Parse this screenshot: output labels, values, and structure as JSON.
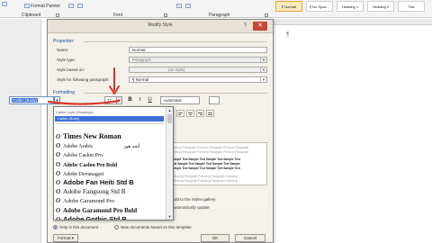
{
  "ribbon": {
    "clipboard_label": "Clipboard",
    "format_painter_label": "Format Painter",
    "font_label": "Font",
    "paragraph_label": "Paragraph",
    "styles": [
      {
        "label": "¶ Normal",
        "selected": true
      },
      {
        "label": "¶ No Spac...",
        "selected": false
      },
      {
        "label": "Heading 1",
        "selected": false
      },
      {
        "label": "Heading 2",
        "selected": false
      },
      {
        "label": "Title",
        "selected": false
      }
    ]
  },
  "document": {
    "paragraph_mark": "¶"
  },
  "dialog": {
    "title": "Modify Style",
    "help_label": "?",
    "close_label": "✕",
    "properties_header": "Properties",
    "fields": [
      {
        "label": "Name:",
        "value": "Normal",
        "disabled": false
      },
      {
        "label": "Style type:",
        "value": "Paragraph",
        "disabled": true
      },
      {
        "label": "Style based on:",
        "value": "(no style)",
        "disabled": true
      },
      {
        "label": "Style for following paragraph:",
        "value": "¶ Normal",
        "disabled": false
      }
    ],
    "formatting_header": "Formatting",
    "font_value": "Calibri (Body)",
    "size_value": "11",
    "bold_label": "B",
    "italic_label": "I",
    "underline_label": "U",
    "color_value": "Automatic",
    "preview_lines": [
      {
        "text": "Previous Paragraph Previous Paragraph Previous Paragraph",
        "style": "grey"
      },
      {
        "text": "Previous Paragraph Previous Paragraph Previous Paragraph",
        "style": "grey"
      },
      {
        "text": "Sample Text Sample Text Sample Text Sample Text",
        "style": "bold"
      },
      {
        "text": "Text Sample Text Sample Text Sample Text Sample",
        "style": "bold"
      },
      {
        "text": "Sample Text Sample Text Sample Text Sample Text",
        "style": "bold"
      },
      {
        "text": "Following Paragraph Following Paragraph Following",
        "style": "grey"
      },
      {
        "text": "Following Paragraph Following Paragraph Following",
        "style": "grey"
      }
    ],
    "add_to_gallery_label": "Add to the Styles gallery",
    "auto_update_label": "Automatically update",
    "only_this_doc_label": "Only in this document",
    "new_docs_label": "New documents based on this template",
    "format_button_label": "Format ▾",
    "ok_label": "OK",
    "cancel_label": "Cancel"
  },
  "font_dropdown": {
    "theme_header": "Calibri Light (Headings)",
    "selected_theme_font": "Calibri (Body)",
    "fonts": [
      {
        "name": "Times New Roman",
        "font": "Liberation Serif",
        "size": 8,
        "bold": true,
        "italic": false
      },
      {
        "name": "Adobe Arabic",
        "font": "Liberation Serif",
        "size": 6,
        "bold": false,
        "italic": false,
        "sample": "أبجد هوز"
      },
      {
        "name": "Adobe Caslon Pro",
        "font": "Liberation Serif",
        "size": 6,
        "bold": false,
        "italic": false
      },
      {
        "name": "Adobe Caslon Pro Bold",
        "font": "Liberation Serif",
        "size": 6,
        "bold": true,
        "italic": false
      },
      {
        "name": "Adobe Devanagari",
        "font": "Liberation Serif",
        "size": 6,
        "bold": false,
        "italic": false
      },
      {
        "name": "Adobe Fan Heiti Std B",
        "font": "Liberation Sans",
        "size": 7.5,
        "bold": true,
        "italic": false
      },
      {
        "name": "Adobe Fangsong Std R",
        "font": "Liberation Serif",
        "size": 7.5,
        "bold": false,
        "italic": false
      },
      {
        "name": "Adobe Garamond Pro",
        "font": "Liberation Serif",
        "size": 6.5,
        "bold": false,
        "italic": false
      },
      {
        "name": "Adobe Garamond Pro Bold",
        "font": "Liberation Serif",
        "size": 7,
        "bold": true,
        "italic": false
      },
      {
        "name": "Adobe Gothic Std B",
        "font": "Liberation Sans",
        "size": 7.5,
        "bold": true,
        "italic": false
      }
    ]
  }
}
